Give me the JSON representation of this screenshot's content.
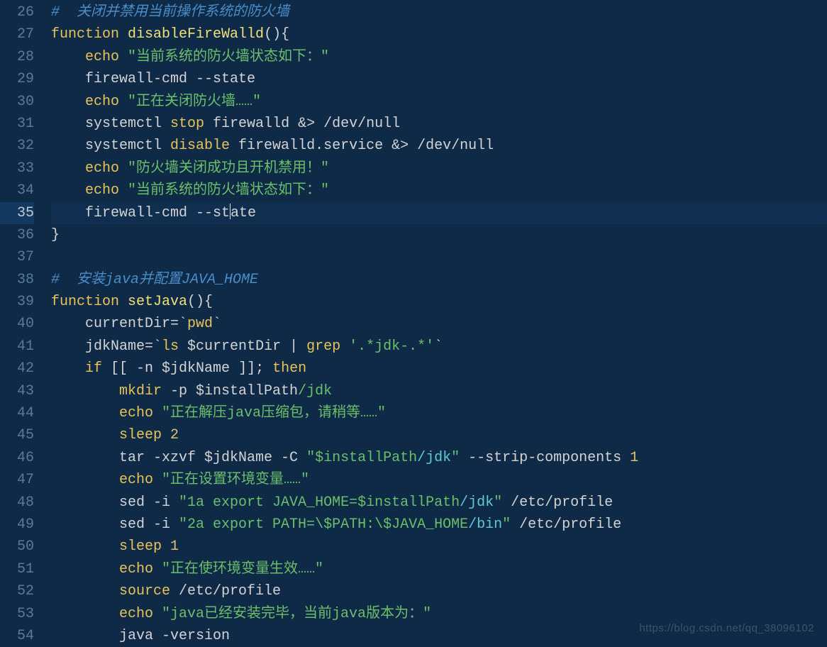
{
  "startLine": 26,
  "currentLineIndex": 9,
  "watermark": "https://blog.csdn.net/qq_38096102",
  "lines": [
    [
      {
        "cls": "c-comment",
        "t": "#  关闭并禁用当前操作系统的防火墙"
      }
    ],
    [
      {
        "cls": "c-keyword",
        "t": "function"
      },
      {
        "cls": "",
        "t": " "
      },
      {
        "cls": "c-funcname",
        "t": "disableFireWalld"
      },
      {
        "cls": "c-punct",
        "t": "(){"
      }
    ],
    [
      {
        "cls": "",
        "t": "    "
      },
      {
        "cls": "c-keyword",
        "t": "echo"
      },
      {
        "cls": "",
        "t": " "
      },
      {
        "cls": "c-string",
        "t": "\"当前系统的防火墙状态如下：\""
      }
    ],
    [
      {
        "cls": "",
        "t": "    firewall-cmd --state"
      }
    ],
    [
      {
        "cls": "",
        "t": "    "
      },
      {
        "cls": "c-keyword",
        "t": "echo"
      },
      {
        "cls": "",
        "t": " "
      },
      {
        "cls": "c-string",
        "t": "\"正在关闭防火墙……\""
      }
    ],
    [
      {
        "cls": "",
        "t": "    systemctl "
      },
      {
        "cls": "c-keyword",
        "t": "stop"
      },
      {
        "cls": "",
        "t": " firewalld "
      },
      {
        "cls": "c-punct",
        "t": "&>"
      },
      {
        "cls": "",
        "t": " /dev/null"
      }
    ],
    [
      {
        "cls": "",
        "t": "    systemctl "
      },
      {
        "cls": "c-keyword",
        "t": "disable"
      },
      {
        "cls": "",
        "t": " firewalld.service "
      },
      {
        "cls": "c-punct",
        "t": "&>"
      },
      {
        "cls": "",
        "t": " /dev/null"
      }
    ],
    [
      {
        "cls": "",
        "t": "    "
      },
      {
        "cls": "c-keyword",
        "t": "echo"
      },
      {
        "cls": "",
        "t": " "
      },
      {
        "cls": "c-string",
        "t": "\"防火墙关闭成功且开机禁用！\""
      }
    ],
    [
      {
        "cls": "",
        "t": "    "
      },
      {
        "cls": "c-keyword",
        "t": "echo"
      },
      {
        "cls": "",
        "t": " "
      },
      {
        "cls": "c-string",
        "t": "\"当前系统的防火墙状态如下：\""
      }
    ],
    [
      {
        "cls": "",
        "t": "    firewall-cmd --st"
      },
      {
        "cls": "cursor-marker",
        "t": ""
      },
      {
        "cls": "",
        "t": "ate"
      }
    ],
    [
      {
        "cls": "c-punct",
        "t": "}"
      }
    ],
    [
      {
        "cls": "",
        "t": ""
      }
    ],
    [
      {
        "cls": "c-comment",
        "t": "#  安装java并配置JAVA_HOME"
      }
    ],
    [
      {
        "cls": "c-keyword",
        "t": "function"
      },
      {
        "cls": "",
        "t": " "
      },
      {
        "cls": "c-funcname",
        "t": "setJava"
      },
      {
        "cls": "c-punct",
        "t": "(){"
      }
    ],
    [
      {
        "cls": "",
        "t": "    currentDir=`"
      },
      {
        "cls": "c-keyword",
        "t": "pwd"
      },
      {
        "cls": "",
        "t": "`"
      }
    ],
    [
      {
        "cls": "",
        "t": "    jdkName=`"
      },
      {
        "cls": "c-keyword",
        "t": "ls"
      },
      {
        "cls": "",
        "t": " $currentDir "
      },
      {
        "cls": "c-punct",
        "t": "|"
      },
      {
        "cls": "",
        "t": " "
      },
      {
        "cls": "c-keyword",
        "t": "grep"
      },
      {
        "cls": "",
        "t": " "
      },
      {
        "cls": "c-string",
        "t": "'.*jdk-.*'"
      },
      {
        "cls": "",
        "t": "`"
      }
    ],
    [
      {
        "cls": "",
        "t": "    "
      },
      {
        "cls": "c-keyword",
        "t": "if"
      },
      {
        "cls": "",
        "t": " [[ -n $jdkName ]]; "
      },
      {
        "cls": "c-keyword",
        "t": "then"
      }
    ],
    [
      {
        "cls": "",
        "t": "        "
      },
      {
        "cls": "c-keyword",
        "t": "mkdir"
      },
      {
        "cls": "",
        "t": " -p $installPath"
      },
      {
        "cls": "c-path",
        "t": "/jdk"
      }
    ],
    [
      {
        "cls": "",
        "t": "        "
      },
      {
        "cls": "c-keyword",
        "t": "echo"
      },
      {
        "cls": "",
        "t": " "
      },
      {
        "cls": "c-string",
        "t": "\"正在解压java压缩包，请稍等……\""
      }
    ],
    [
      {
        "cls": "",
        "t": "        "
      },
      {
        "cls": "c-keyword",
        "t": "sleep"
      },
      {
        "cls": "",
        "t": " "
      },
      {
        "cls": "c-number",
        "t": "2"
      }
    ],
    [
      {
        "cls": "",
        "t": "        tar -xzvf $jdkName -C "
      },
      {
        "cls": "c-string",
        "t": "\"$installPath"
      },
      {
        "cls": "c-cyan",
        "t": "/jdk"
      },
      {
        "cls": "c-string",
        "t": "\""
      },
      {
        "cls": "",
        "t": " --strip-components "
      },
      {
        "cls": "c-number",
        "t": "1"
      }
    ],
    [
      {
        "cls": "",
        "t": "        "
      },
      {
        "cls": "c-keyword",
        "t": "echo"
      },
      {
        "cls": "",
        "t": " "
      },
      {
        "cls": "c-string",
        "t": "\"正在设置环境变量……\""
      }
    ],
    [
      {
        "cls": "",
        "t": "        sed -i "
      },
      {
        "cls": "c-string",
        "t": "\"1a export JAVA_HOME=$installPath"
      },
      {
        "cls": "c-cyan",
        "t": "/jdk"
      },
      {
        "cls": "c-string",
        "t": "\""
      },
      {
        "cls": "",
        "t": " /etc/profile"
      }
    ],
    [
      {
        "cls": "",
        "t": "        sed -i "
      },
      {
        "cls": "c-string",
        "t": "\"2a export PATH=\\$PATH:\\$JAVA_HOME"
      },
      {
        "cls": "c-cyan",
        "t": "/bin"
      },
      {
        "cls": "c-string",
        "t": "\""
      },
      {
        "cls": "",
        "t": " /etc/profile"
      }
    ],
    [
      {
        "cls": "",
        "t": "        "
      },
      {
        "cls": "c-keyword",
        "t": "sleep"
      },
      {
        "cls": "",
        "t": " "
      },
      {
        "cls": "c-number",
        "t": "1"
      }
    ],
    [
      {
        "cls": "",
        "t": "        "
      },
      {
        "cls": "c-keyword",
        "t": "echo"
      },
      {
        "cls": "",
        "t": " "
      },
      {
        "cls": "c-string",
        "t": "\"正在使环境变量生效……\""
      }
    ],
    [
      {
        "cls": "",
        "t": "        "
      },
      {
        "cls": "c-keyword",
        "t": "source"
      },
      {
        "cls": "",
        "t": " /etc/profile"
      }
    ],
    [
      {
        "cls": "",
        "t": "        "
      },
      {
        "cls": "c-keyword",
        "t": "echo"
      },
      {
        "cls": "",
        "t": " "
      },
      {
        "cls": "c-string",
        "t": "\"java已经安装完毕，当前java版本为：\""
      }
    ],
    [
      {
        "cls": "",
        "t": "        java -version"
      }
    ]
  ]
}
